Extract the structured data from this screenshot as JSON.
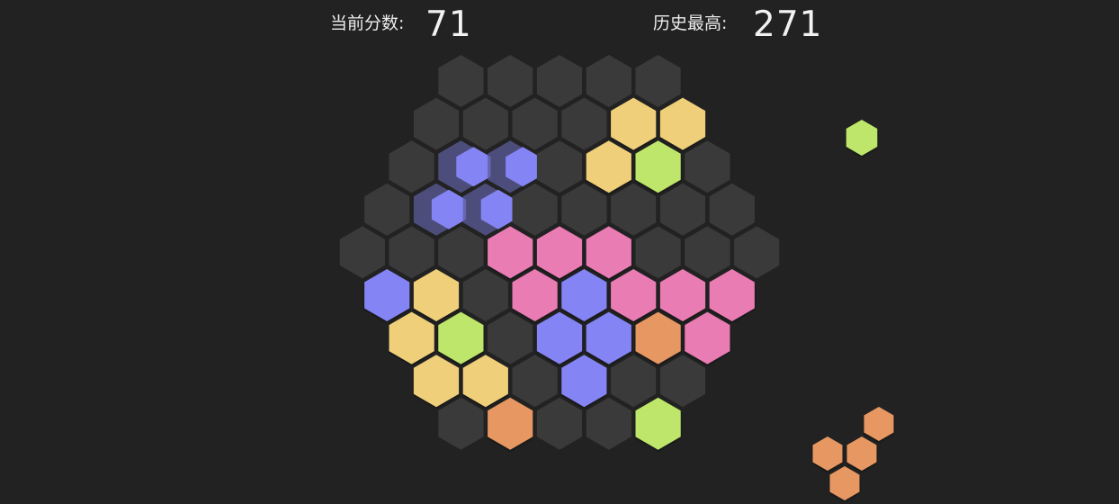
{
  "header": {
    "current_score_label": "当前分数:",
    "current_score_value": "71",
    "best_score_label": "历史最高:",
    "best_score_value": "271"
  },
  "colors": {
    "background": "#222222",
    "empty": "#3a3a3a",
    "yellow": "#f0cf7a",
    "green": "#bde66a",
    "blue": "#8484f4",
    "pink": "#ea7bb4",
    "orange": "#e69762",
    "ghost": "#5c5c9a"
  },
  "board": {
    "description_rows": [
      "row 0..8, each row lists cell colors left to right",
      "e = empty"
    ],
    "rows": [
      [
        "e",
        "e",
        "e",
        "e",
        "e"
      ],
      [
        "e",
        "e",
        "e",
        "e",
        "yellow",
        "yellow"
      ],
      [
        "e",
        "ghost-blue",
        "ghost-blue",
        "e",
        "yellow",
        "green",
        "e"
      ],
      [
        "e",
        "ghost-blue",
        "ghost-blue",
        "e",
        "e",
        "e",
        "e",
        "e"
      ],
      [
        "e",
        "e",
        "e",
        "pink",
        "pink",
        "pink",
        "e",
        "e",
        "e"
      ],
      [
        "blue",
        "yellow",
        "e",
        "pink",
        "blue",
        "pink",
        "pink",
        "pink"
      ],
      [
        "yellow",
        "green",
        "e",
        "blue",
        "blue",
        "orange",
        "pink"
      ],
      [
        "yellow",
        "yellow",
        "e",
        "blue",
        "e",
        "e"
      ],
      [
        "e",
        "orange",
        "e",
        "e",
        "green"
      ]
    ]
  },
  "pieces": [
    {
      "name": "next-piece-green-single",
      "color": "green",
      "cells": 1
    },
    {
      "name": "next-piece-orange-four",
      "color": "orange",
      "cells": 4
    }
  ]
}
